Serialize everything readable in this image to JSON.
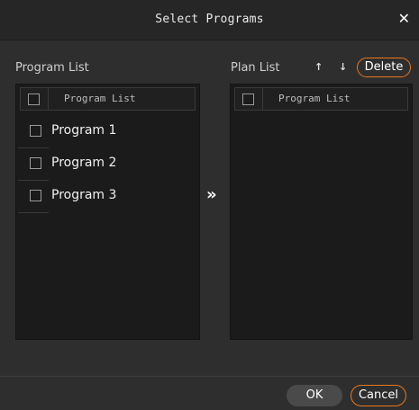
{
  "dialog": {
    "title": "Select Programs",
    "close_glyph": "✕"
  },
  "left": {
    "label": "Program List",
    "header": "Program List",
    "items": [
      {
        "label": "Program 1",
        "checked": false
      },
      {
        "label": "Program 2",
        "checked": false
      },
      {
        "label": "Program 3",
        "checked": false
      }
    ]
  },
  "transfer_glyph": "»",
  "right": {
    "label": "Plan List",
    "up_glyph": "↑",
    "down_glyph": "↓",
    "delete_label": "Delete",
    "header": "Program List"
  },
  "footer": {
    "ok_label": "OK",
    "cancel_label": "Cancel"
  },
  "colors": {
    "accent": "#e8771f",
    "background": "#2e2e2e",
    "panel": "#1b1b1b"
  }
}
